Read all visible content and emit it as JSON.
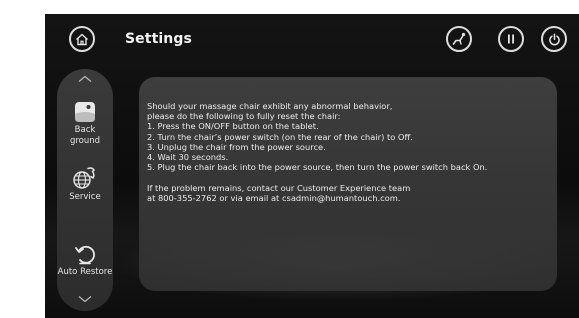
{
  "header": {
    "title": "Settings",
    "home_icon": "home-icon",
    "stretch_icon": "stretch-icon",
    "pause_icon": "pause-icon",
    "power_icon": "power-icon"
  },
  "sidebar": {
    "items": [
      {
        "label": "Back\nground",
        "icon": "background-icon"
      },
      {
        "label": "Service",
        "icon": "service-icon"
      },
      {
        "label": "Auto Restore",
        "icon": "auto-restore-icon"
      }
    ]
  },
  "panel": {
    "lines": [
      "Should your massage chair exhibit any abnormal behavior,",
      "please do the following to fully reset the chair:",
      "1. Press the ON/OFF button on the tablet.",
      "2. Turn the chair’s power switch (on the rear of the chair) to Off.",
      "3. Unplug the chair from the power source.",
      "4. Wait 30 seconds.",
      "5. Plug the chair back into the power source, then turn the power switch back On."
    ],
    "contact_lines": [
      "If the problem remains, contact our Customer Experience team",
      "at 800-355-2762 or via email at csadmin@humantouch.com."
    ]
  }
}
